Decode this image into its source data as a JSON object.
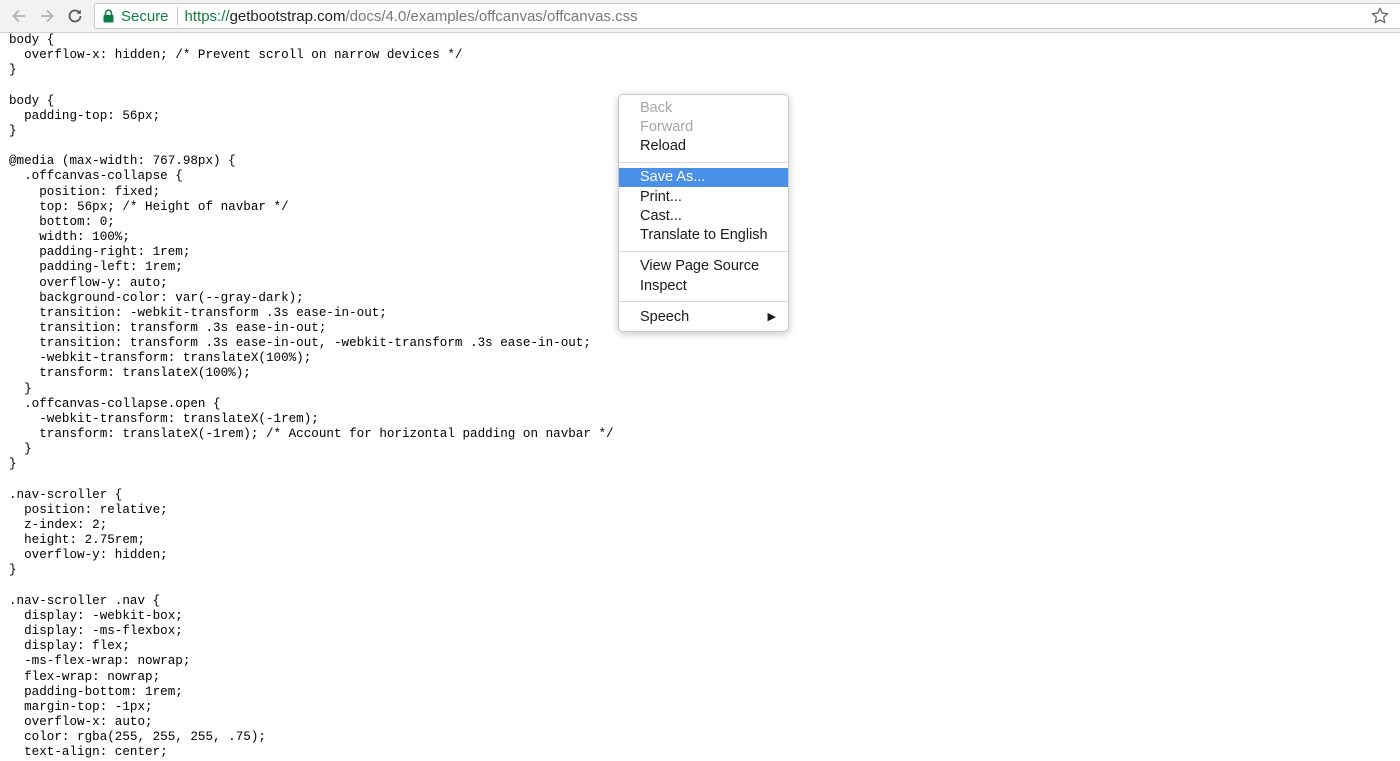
{
  "browser": {
    "url_scheme": "https://",
    "url_host": "getbootstrap.com",
    "url_path": "/docs/4.0/examples/offcanvas/offcanvas.css",
    "secure_label": "Secure"
  },
  "page": {
    "source": "body {\n  overflow-x: hidden; /* Prevent scroll on narrow devices */\n}\n\nbody {\n  padding-top: 56px;\n}\n\n@media (max-width: 767.98px) {\n  .offcanvas-collapse {\n    position: fixed;\n    top: 56px; /* Height of navbar */\n    bottom: 0;\n    width: 100%;\n    padding-right: 1rem;\n    padding-left: 1rem;\n    overflow-y: auto;\n    background-color: var(--gray-dark);\n    transition: -webkit-transform .3s ease-in-out;\n    transition: transform .3s ease-in-out;\n    transition: transform .3s ease-in-out, -webkit-transform .3s ease-in-out;\n    -webkit-transform: translateX(100%);\n    transform: translateX(100%);\n  }\n  .offcanvas-collapse.open {\n    -webkit-transform: translateX(-1rem);\n    transform: translateX(-1rem); /* Account for horizontal padding on navbar */\n  }\n}\n\n.nav-scroller {\n  position: relative;\n  z-index: 2;\n  height: 2.75rem;\n  overflow-y: hidden;\n}\n\n.nav-scroller .nav {\n  display: -webkit-box;\n  display: -ms-flexbox;\n  display: flex;\n  -ms-flex-wrap: nowrap;\n  flex-wrap: nowrap;\n  padding-bottom: 1rem;\n  margin-top: -1px;\n  overflow-x: auto;\n  color: rgba(255, 255, 255, .75);\n  text-align: center;"
  },
  "context_menu": {
    "back": "Back",
    "forward": "Forward",
    "reload": "Reload",
    "save_as": "Save As...",
    "print": "Print...",
    "cast": "Cast...",
    "translate": "Translate to English",
    "view_source": "View Page Source",
    "inspect": "Inspect",
    "speech": "Speech",
    "submenu_arrow": "▶"
  },
  "colors": {
    "secure_green": "#0b8043",
    "menu_highlight": "#4a90e8"
  }
}
